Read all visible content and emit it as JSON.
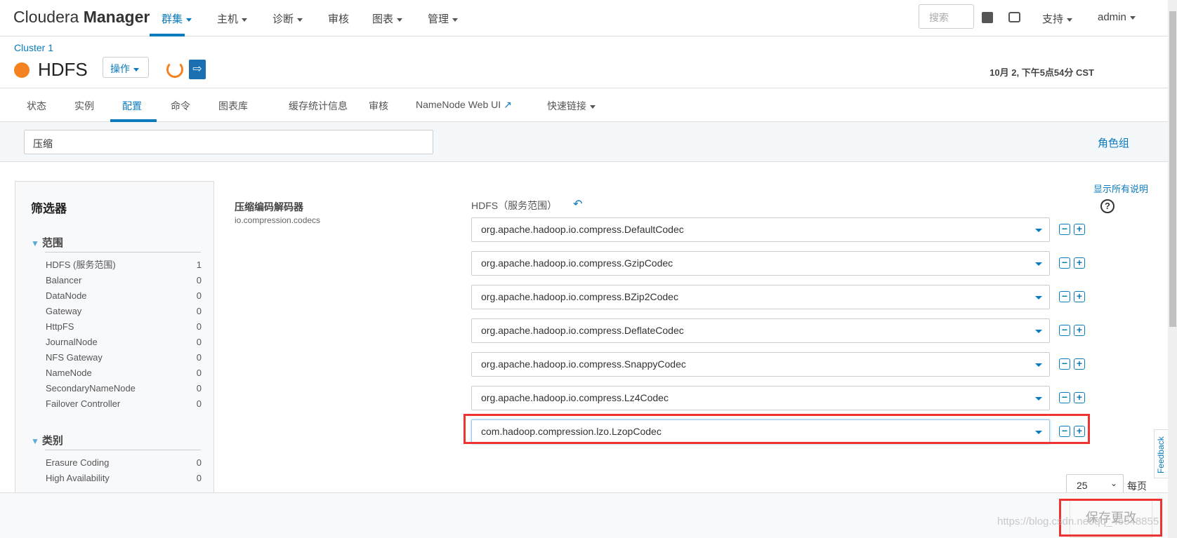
{
  "topnav": {
    "logo_light": "Cloudera",
    "logo_bold": "Manager",
    "items": [
      {
        "label": "群集"
      },
      {
        "label": "主机"
      },
      {
        "label": "诊断"
      },
      {
        "label": "审核"
      },
      {
        "label": "图表"
      },
      {
        "label": "管理"
      }
    ],
    "search_placeholder": "搜索",
    "support": "支持",
    "user": "admin"
  },
  "service": {
    "cluster": "Cluster 1",
    "name": "HDFS",
    "status_color": "#f58220",
    "actions": "操作",
    "timestamp": "10月 2, 下午5点54分 CST"
  },
  "tabs": [
    {
      "label": "状态"
    },
    {
      "label": "实例"
    },
    {
      "label": "配置"
    },
    {
      "label": "命令"
    },
    {
      "label": "图表库"
    },
    {
      "label": "缓存统计信息"
    },
    {
      "label": "审核"
    },
    {
      "label": "NameNode Web UI"
    },
    {
      "label": "快速链接"
    }
  ],
  "filterbar": {
    "value": "压缩",
    "role_groups": "角色组"
  },
  "filters": {
    "title": "筛选器",
    "scope": {
      "title": "范围",
      "items": [
        {
          "label": "HDFS (服务范围)",
          "count": "1"
        },
        {
          "label": "Balancer",
          "count": "0"
        },
        {
          "label": "DataNode",
          "count": "0"
        },
        {
          "label": "Gateway",
          "count": "0"
        },
        {
          "label": "HttpFS",
          "count": "0"
        },
        {
          "label": "JournalNode",
          "count": "0"
        },
        {
          "label": "NFS Gateway",
          "count": "0"
        },
        {
          "label": "NameNode",
          "count": "0"
        },
        {
          "label": "SecondaryNameNode",
          "count": "0"
        },
        {
          "label": "Failover Controller",
          "count": "0"
        }
      ]
    },
    "category": {
      "title": "类别",
      "items": [
        {
          "label": "Erasure Coding",
          "count": "0"
        },
        {
          "label": "High Availability",
          "count": "0"
        }
      ]
    }
  },
  "config": {
    "label": "压缩编码解码器",
    "key": "io.compression.codecs",
    "scope": "HDFS（服务范围）",
    "show_all": "显示所有说明",
    "help": "?",
    "values": [
      "org.apache.hadoop.io.compress.DefaultCodec",
      "org.apache.hadoop.io.compress.GzipCodec",
      "org.apache.hadoop.io.compress.BZip2Codec",
      "org.apache.hadoop.io.compress.DeflateCodec",
      "org.apache.hadoop.io.compress.SnappyCodec",
      "org.apache.hadoop.io.compress.Lz4Codec",
      "com.hadoop.compression.lzo.LzopCodec"
    ]
  },
  "pagination": {
    "per_page": "25",
    "per_page_label": "每页"
  },
  "footer": {
    "save": "保存更改"
  },
  "feedback": "Feedback",
  "watermark": "https://blog.csdn.net/qq_46548855"
}
